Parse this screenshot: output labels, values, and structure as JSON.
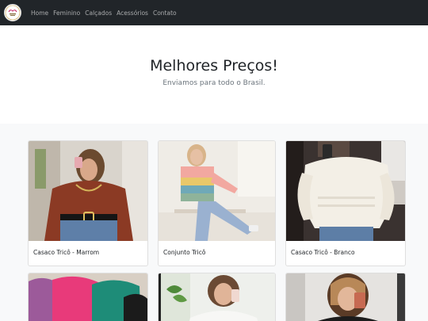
{
  "navbar": {
    "brand_alt": "logo",
    "links": [
      "Home",
      "Feminino",
      "Calçados",
      "Acessórios",
      "Contato"
    ]
  },
  "hero": {
    "title": "Melhores Preços!",
    "subtitle": "Enviamos para todo o Brasil."
  },
  "products": [
    {
      "name": "Casaco Tricô - Marrom",
      "image": "brown-sweater-photo"
    },
    {
      "name": "Conjunto Tricô",
      "image": "striped-sweater-photo"
    },
    {
      "name": "Casaco Tricô - Branco",
      "image": "white-sweater-photo"
    },
    {
      "name": "",
      "image": "colored-knits-photo"
    },
    {
      "name": "",
      "image": "white-blouse-photo"
    },
    {
      "name": "",
      "image": "black-top-photo"
    }
  ],
  "colors": {
    "navbar": "#212529",
    "hero_bg": "#ffffff",
    "album_bg": "#f8f9fa",
    "muted_text": "#6c757d"
  }
}
